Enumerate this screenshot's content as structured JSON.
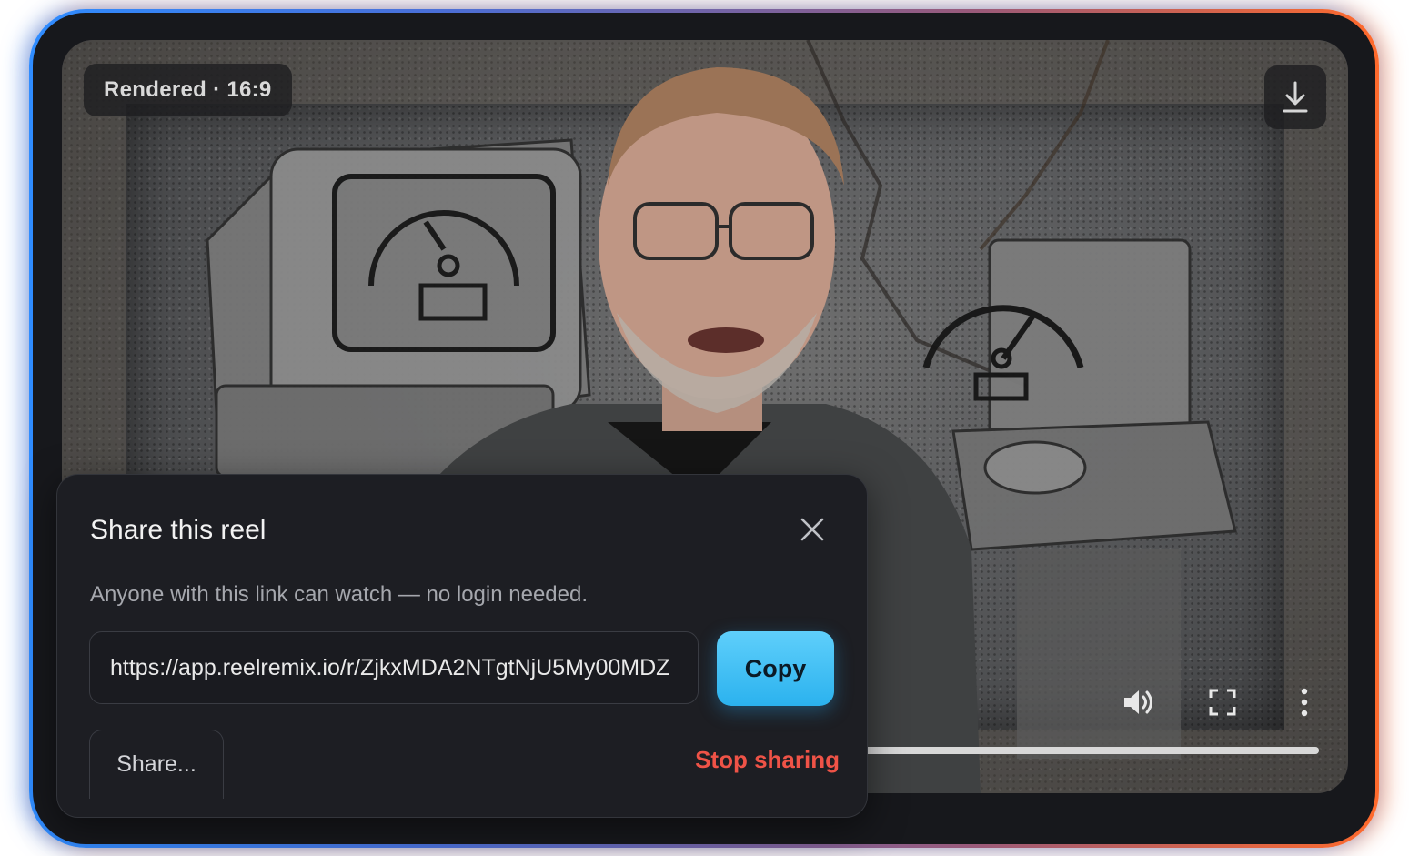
{
  "player": {
    "badge_label": "Rendered · 16:9",
    "progress_fraction": 1.0,
    "icons": {
      "download": "download-icon",
      "volume": "volume-icon",
      "fullscreen": "fullscreen-icon",
      "more": "more-vertical-icon"
    }
  },
  "share_dialog": {
    "title": "Share this reel",
    "description": "Anyone with this link can watch — no login needed.",
    "link_value": "https://app.reelremix.io/r/ZjkxMDA2NTgtNjU5My00MDZ",
    "copy_label": "Copy",
    "share_more_label": "Share...",
    "stop_sharing_label": "Stop sharing",
    "close_icon": "close-icon"
  },
  "colors": {
    "accent": "#2bb2ee",
    "danger": "#ef5347",
    "panel": "#1d1e23",
    "frame_glow_left": "#2f8cff",
    "frame_glow_right": "#ff6a2c"
  }
}
